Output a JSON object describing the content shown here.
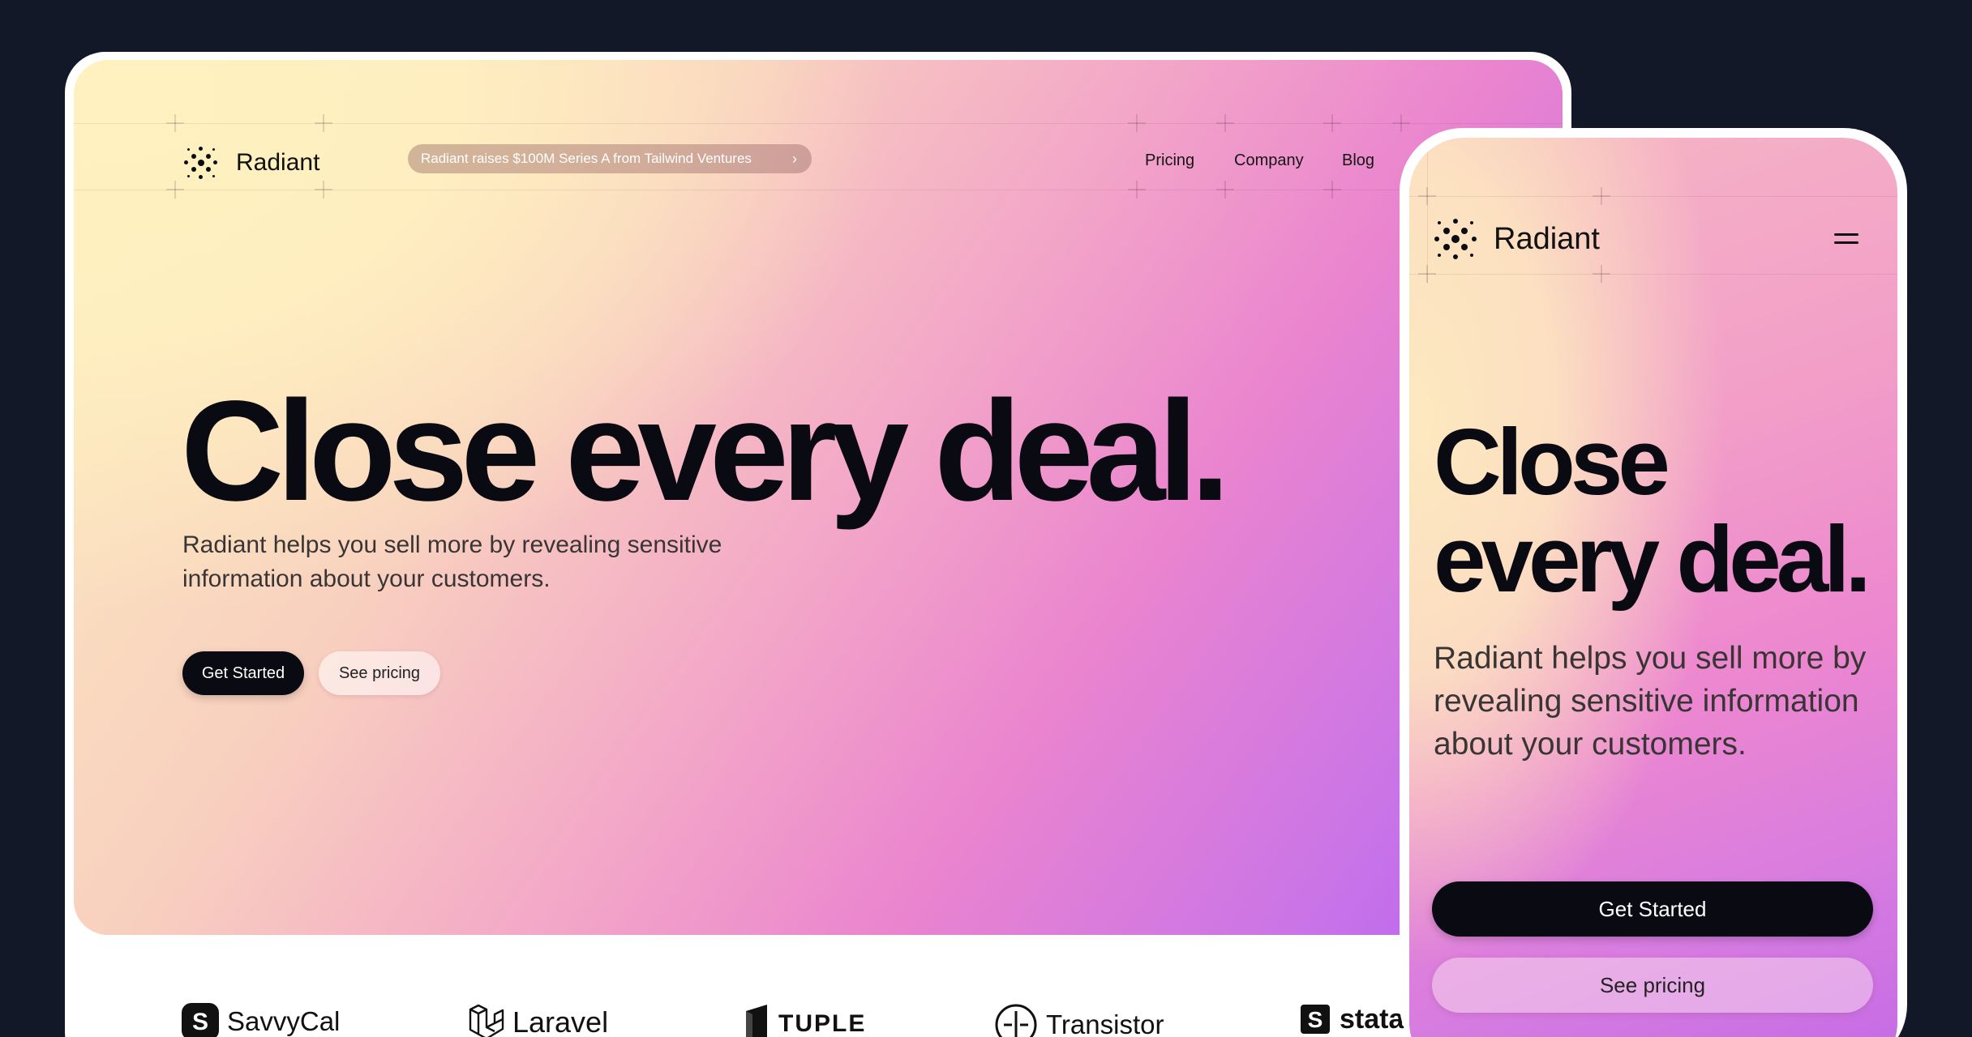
{
  "desktop": {
    "brand": "Radiant",
    "announcement": "Radiant raises $100M Series A from Tailwind Ventures",
    "announcement_chevron": "›",
    "nav": [
      "Pricing",
      "Company",
      "Blog"
    ],
    "headline": "Close every deal.",
    "subtext": "Radiant helps you sell more by revealing sensitive information about your customers.",
    "primary_cta": "Get Started",
    "secondary_cta": "See pricing",
    "logos": [
      "SavvyCal",
      "Laravel",
      "TUPLE",
      "Transistor",
      "stata"
    ]
  },
  "mobile": {
    "brand": "Radiant",
    "headline": "Close every deal.",
    "subtext": "Radiant helps you sell more by revealing sensitive information about your customers.",
    "primary_cta": "Get Started",
    "secondary_cta": "See pricing"
  },
  "colors": {
    "background": "#121828",
    "accent_dark": "#0a0a12",
    "gradient_start": "#fdeec0",
    "gradient_mid": "#ea84cf",
    "gradient_end": "#b560f2"
  },
  "icons": [
    "radiant-logo-icon",
    "chevron-right-icon",
    "hamburger-menu-icon",
    "savvycal-logo-icon",
    "laravel-logo-icon",
    "tuple-logo-icon",
    "transistor-logo-icon",
    "statamic-logo-icon"
  ]
}
